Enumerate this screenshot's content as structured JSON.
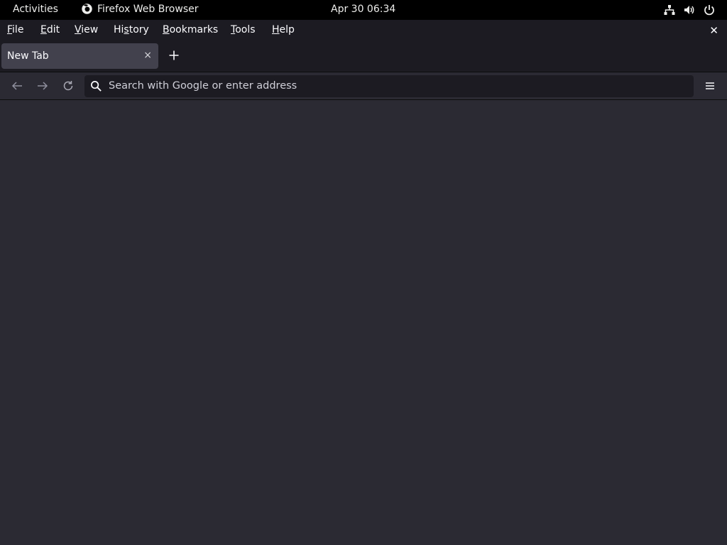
{
  "topbar": {
    "activities": "Activities",
    "app_name": "Firefox Web Browser",
    "clock": "Apr 30  06:34",
    "icons": [
      "network-icon",
      "volume-icon",
      "power-icon"
    ]
  },
  "menubar": {
    "items": [
      {
        "label": "File",
        "mnemonic": "F"
      },
      {
        "label": "Edit",
        "mnemonic": "E"
      },
      {
        "label": "View",
        "mnemonic": "V"
      },
      {
        "label": "History",
        "mnemonic": "s"
      },
      {
        "label": "Bookmarks",
        "mnemonic": "B"
      },
      {
        "label": "Tools",
        "mnemonic": "T"
      },
      {
        "label": "Help",
        "mnemonic": "H"
      }
    ],
    "close_glyph": "✕"
  },
  "tabs": [
    {
      "title": "New Tab",
      "active": true
    }
  ],
  "tab_close_glyph": "×",
  "navbar": {
    "search_placeholder": "Search with Google or enter address"
  },
  "colors": {
    "topbar_bg": "#000000",
    "chrome_bg": "#1c1b22",
    "toolbar_bg": "#2b2a33",
    "tab_active_bg": "#42414d",
    "text": "#fbfbfe"
  }
}
